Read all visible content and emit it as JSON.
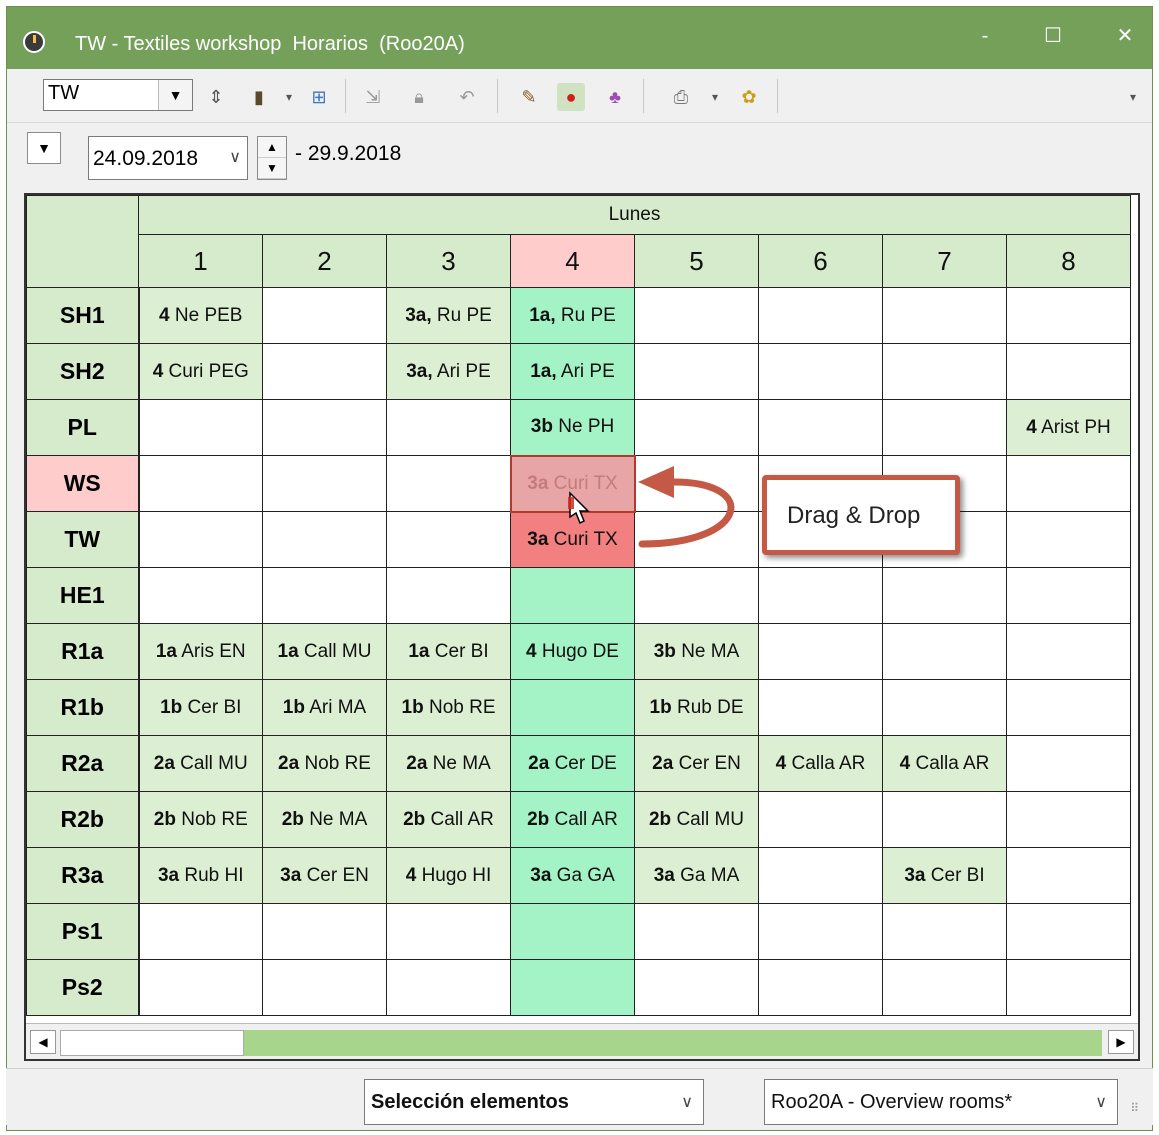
{
  "window": {
    "title": "TW - Textiles workshop  Horarios  (Roo20A)",
    "minimize": "-",
    "maximize": "☐",
    "close": "✕"
  },
  "toolbar": {
    "element_value": "TW",
    "icons": [
      "up-down-icon",
      "door-icon",
      "dropdown-arrow-icon",
      "grid-plus-icon",
      "import-icon",
      "lock-icon",
      "undo-icon",
      "palette-icon",
      "pin-icon",
      "people-icon",
      "print-icon",
      "settings-icon"
    ]
  },
  "dates": {
    "start": "24.09.2018",
    "end": "- 29.9.2018"
  },
  "timetable": {
    "day": "Lunes",
    "hours": [
      "1",
      "2",
      "3",
      "4",
      "5",
      "6",
      "7",
      "8"
    ],
    "active_hour_index": 3,
    "rooms": [
      {
        "name": "SH1",
        "cells": [
          [
            "4",
            "Ne PEB"
          ],
          null,
          [
            "3a,",
            "Ru PE"
          ],
          [
            "1a,",
            "Ru PE"
          ],
          null,
          null,
          null,
          null
        ]
      },
      {
        "name": "SH2",
        "cells": [
          [
            "4",
            "Curi PEG"
          ],
          null,
          [
            "3a,",
            "Ari PE"
          ],
          [
            "1a,",
            "Ari PE"
          ],
          null,
          null,
          null,
          null
        ]
      },
      {
        "name": "PL",
        "cells": [
          null,
          null,
          null,
          [
            "3b",
            "Ne PH"
          ],
          null,
          null,
          null,
          [
            "4",
            "Arist PH"
          ]
        ]
      },
      {
        "name": "WS",
        "cells": [
          null,
          null,
          null,
          [
            "3a",
            "Curi TX"
          ],
          null,
          null,
          null,
          null
        ]
      },
      {
        "name": "TW",
        "cells": [
          null,
          null,
          null,
          [
            "3a",
            "Curi TX"
          ],
          null,
          null,
          null,
          null
        ]
      },
      {
        "name": "HE1",
        "cells": [
          null,
          null,
          null,
          null,
          null,
          null,
          null,
          null
        ]
      },
      {
        "name": "R1a",
        "cells": [
          [
            "1a",
            "Aris EN"
          ],
          [
            "1a",
            "Call MU"
          ],
          [
            "1a",
            "Cer BI"
          ],
          [
            "4",
            "Hugo DE"
          ],
          [
            "3b",
            "Ne MA"
          ],
          null,
          null,
          null
        ]
      },
      {
        "name": "R1b",
        "cells": [
          [
            "1b",
            "Cer BI"
          ],
          [
            "1b",
            "Ari MA"
          ],
          [
            "1b",
            "Nob RE"
          ],
          null,
          [
            "1b",
            "Rub DE"
          ],
          null,
          null,
          null
        ]
      },
      {
        "name": "R2a",
        "cells": [
          [
            "2a",
            "Call MU"
          ],
          [
            "2a",
            "Nob RE"
          ],
          [
            "2a",
            "Ne MA"
          ],
          [
            "2a",
            "Cer DE"
          ],
          [
            "2a",
            "Cer EN"
          ],
          [
            "4",
            "Calla AR"
          ],
          [
            "4",
            "Calla AR"
          ],
          null
        ]
      },
      {
        "name": "R2b",
        "cells": [
          [
            "2b",
            "Nob RE"
          ],
          [
            "2b",
            "Ne MA"
          ],
          [
            "2b",
            "Call AR"
          ],
          [
            "2b",
            "Call AR"
          ],
          [
            "2b",
            "Call MU"
          ],
          null,
          null,
          null
        ]
      },
      {
        "name": "R3a",
        "cells": [
          [
            "3a",
            "Rub HI"
          ],
          [
            "3a",
            "Cer EN"
          ],
          [
            "4",
            "Hugo HI"
          ],
          [
            "3a",
            "Ga GA"
          ],
          [
            "3a",
            "Ga MA"
          ],
          null,
          [
            "3a",
            "Cer BI"
          ],
          null
        ]
      },
      {
        "name": "Ps1",
        "cells": [
          null,
          null,
          null,
          null,
          null,
          null,
          null,
          null
        ]
      },
      {
        "name": "Ps2",
        "cells": [
          null,
          null,
          null,
          null,
          null,
          null,
          null,
          null
        ]
      }
    ]
  },
  "annotation": {
    "label": "Drag & Drop"
  },
  "statusbar": {
    "selection": "Selección elementos",
    "view": "Roo20A - Overview rooms*"
  },
  "colors": {
    "titlebar": "#74a05a",
    "header": "#d6ebcc",
    "active": "#ffcccc",
    "column_highlight": "#a3f3c6",
    "conflict": "#f28080",
    "callout_border": "#c45a45"
  }
}
